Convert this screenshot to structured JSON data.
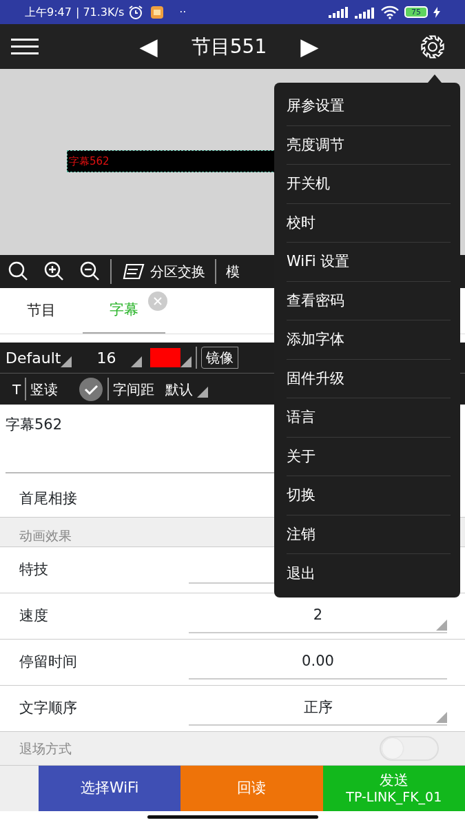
{
  "status_bar": {
    "time": "上午9:47",
    "speed": "| 71.3K/s",
    "dots": "··",
    "battery": "75"
  },
  "title_bar": {
    "prev": "◀",
    "title": "节目551",
    "next": "▶"
  },
  "preview": {
    "caption": "字幕562"
  },
  "tool_bar": {
    "swap": "分区交换",
    "template": "模"
  },
  "tabs": [
    {
      "label": "节目",
      "selected": false
    },
    {
      "label": "字幕",
      "selected": true,
      "closable": true
    }
  ],
  "font_bar": {
    "font": "Default",
    "size": "16",
    "color": "#ff0000",
    "mirror": "镜像"
  },
  "style_bar": {
    "t": "T",
    "vertical": "竖读",
    "vertical_checked": true,
    "spacing_label": "字间距",
    "spacing": "默认"
  },
  "text": "字幕562",
  "rows": [
    {
      "kind": "plain",
      "label": "首尾相接"
    },
    {
      "kind": "header",
      "label": "动画效果"
    },
    {
      "kind": "plain",
      "label": "特技"
    },
    {
      "kind": "select",
      "label": "速度",
      "value": "2"
    },
    {
      "kind": "input",
      "label": "停留时间",
      "value": "0.00"
    },
    {
      "kind": "select",
      "label": "文字顺序",
      "value": "正序"
    },
    {
      "kind": "toggle",
      "label": "退场方式",
      "on": false
    }
  ],
  "buttons": [
    {
      "label": "选择WiFi",
      "color": "#3f4fb4"
    },
    {
      "label": "回读",
      "color": "#ee7309"
    },
    {
      "label": "发送",
      "sub": "TP-LINK_FK_01",
      "color": "#12b81c"
    }
  ],
  "menu": [
    {
      "label": "屏参设置"
    },
    {
      "label": "亮度调节"
    },
    {
      "label": "开关机"
    },
    {
      "label": "校时"
    },
    {
      "label": "WiFi 设置"
    },
    {
      "label": "查看密码"
    },
    {
      "label": "添加字体"
    },
    {
      "label": "固件升级"
    },
    {
      "label": "语言"
    },
    {
      "label": "关于"
    },
    {
      "label": "切换"
    },
    {
      "label": "注销"
    },
    {
      "label": "退出"
    }
  ]
}
